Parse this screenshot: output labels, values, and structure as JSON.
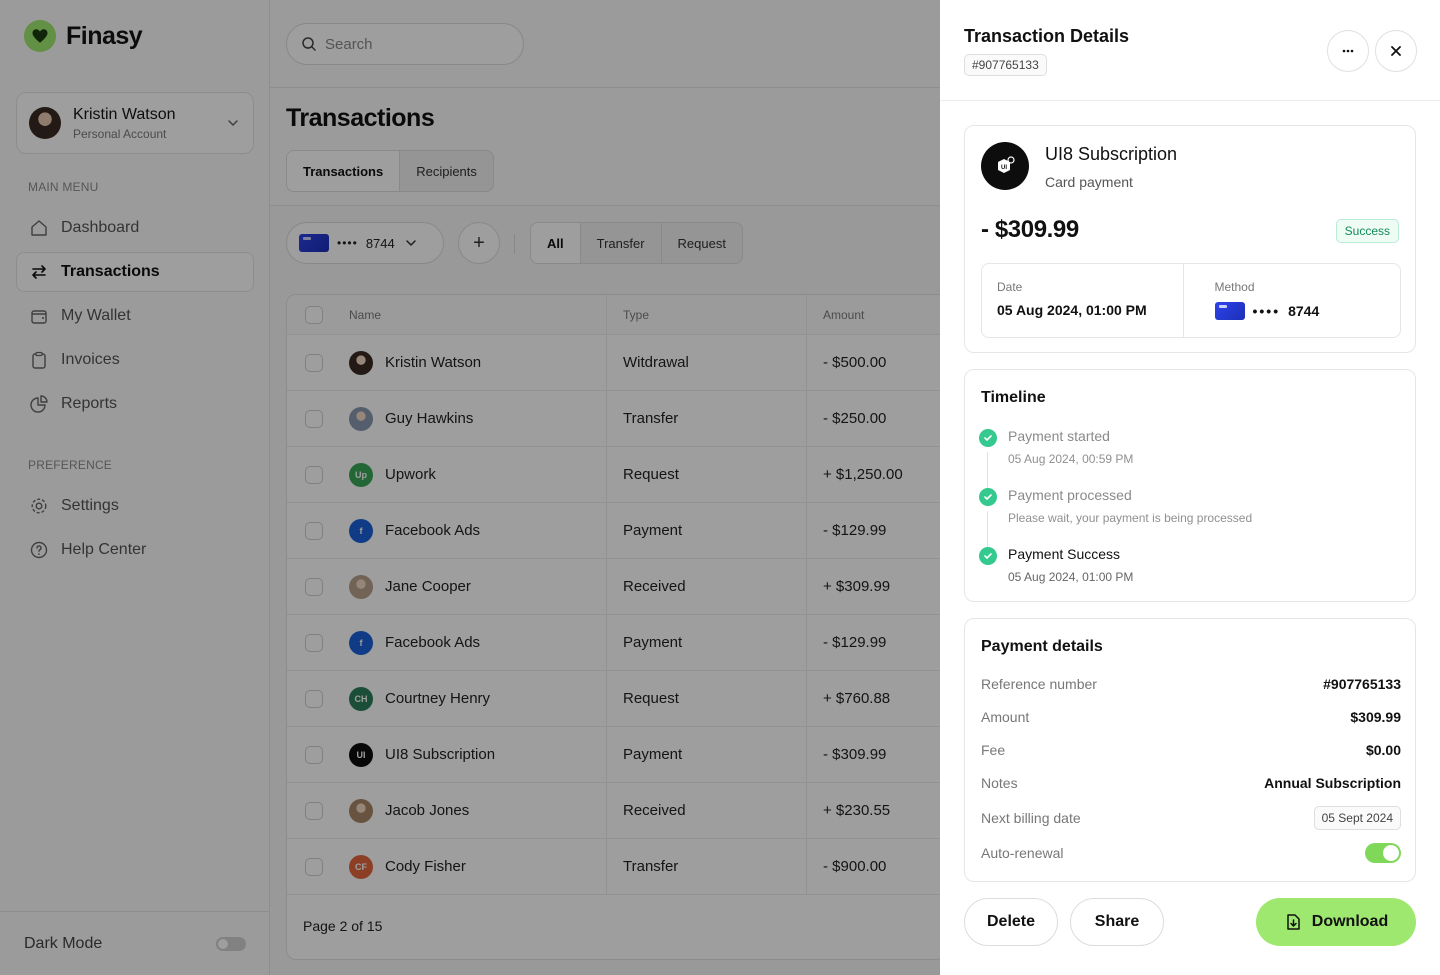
{
  "app": {
    "brand": "Finasy",
    "account": {
      "name": "Kristin Watson",
      "subtitle": "Personal Account"
    },
    "main_menu_label": "MAIN MENU",
    "preference_label": "PREFERENCE",
    "nav": [
      {
        "label": "Dashboard",
        "icon": "home-icon"
      },
      {
        "label": "Transactions",
        "icon": "transfer-icon",
        "active": true
      },
      {
        "label": "My Wallet",
        "icon": "wallet-icon"
      },
      {
        "label": "Invoices",
        "icon": "clipboard-icon"
      },
      {
        "label": "Reports",
        "icon": "pie-chart-icon"
      }
    ],
    "pref_nav": [
      {
        "label": "Settings",
        "icon": "gear-icon"
      },
      {
        "label": "Help Center",
        "icon": "help-icon"
      }
    ],
    "dark_mode_label": "Dark Mode"
  },
  "main": {
    "search_placeholder": "Search",
    "page_title": "Transactions",
    "tabs": [
      "Transactions",
      "Recipients"
    ],
    "card_last4": "8744",
    "card_dots": "••••",
    "plus_label": "+",
    "filters": [
      "All",
      "Transfer",
      "Request"
    ],
    "table": {
      "columns": [
        "Name",
        "Type",
        "Amount"
      ],
      "rows": [
        {
          "name": "Kristin Watson",
          "type": "Witdrawal",
          "amount": "- $500.00",
          "avatar": "photo",
          "color": "#3a2a22",
          "initials": ""
        },
        {
          "name": "Guy Hawkins",
          "type": "Transfer",
          "amount": "- $250.00",
          "avatar": "photo",
          "color": "#8a98b0",
          "initials": ""
        },
        {
          "name": "Upwork",
          "type": "Request",
          "amount": "+ $1,250.00",
          "avatar": "logo",
          "color": "#3aa757",
          "initials": "Up"
        },
        {
          "name": "Facebook Ads",
          "type": "Payment",
          "amount": "- $129.99",
          "avatar": "logo",
          "color": "#1a5fd8",
          "initials": "f"
        },
        {
          "name": "Jane Cooper",
          "type": "Received",
          "amount": "+ $309.99",
          "avatar": "photo",
          "color": "#b7a08c",
          "initials": ""
        },
        {
          "name": "Facebook Ads",
          "type": "Payment",
          "amount": "- $129.99",
          "avatar": "logo",
          "color": "#1a5fd8",
          "initials": "f"
        },
        {
          "name": "Courtney Henry",
          "type": "Request",
          "amount": "+ $760.88",
          "avatar": "initials",
          "color": "#2d7f5c",
          "initials": "CH"
        },
        {
          "name": "UI8 Subscription",
          "type": "Payment",
          "amount": "- $309.99",
          "avatar": "logo",
          "color": "#0d0d0d",
          "initials": "UI"
        },
        {
          "name": "Jacob Jones",
          "type": "Received",
          "amount": "+ $230.55",
          "avatar": "photo",
          "color": "#a8866a",
          "initials": ""
        },
        {
          "name": "Cody Fisher",
          "type": "Transfer",
          "amount": "- $900.00",
          "avatar": "initials",
          "color": "#e2663c",
          "initials": "CF"
        }
      ]
    },
    "pager": "Page 2 of 15"
  },
  "drawer": {
    "title": "Transaction Details",
    "id": "#907765133",
    "summary": {
      "merchant": "UI8 Subscription",
      "method_label": "Card payment",
      "amount": "- $309.99",
      "status": "Success",
      "date_label": "Date",
      "date_value": "05 Aug 2024, 01:00 PM",
      "method_title": "Method",
      "card_dots": "••••",
      "card_last4": "8744"
    },
    "timeline": {
      "title": "Timeline",
      "items": [
        {
          "title": "Payment started",
          "desc": "05 Aug 2024, 00:59 PM"
        },
        {
          "title": "Payment processed",
          "desc": "Please wait, your payment is being processed"
        },
        {
          "title": "Payment Success",
          "desc": "05 Aug 2024, 01:00 PM"
        }
      ]
    },
    "payment": {
      "title": "Payment details",
      "rows": [
        {
          "label": "Reference number",
          "value": "#907765133"
        },
        {
          "label": "Amount",
          "value": "$309.99"
        },
        {
          "label": "Fee",
          "value": "$0.00"
        },
        {
          "label": "Notes",
          "value": "Annual Subscription"
        }
      ],
      "next_billing_label": "Next billing date",
      "next_billing_value": "05 Sept 2024",
      "auto_renewal_label": "Auto-renewal",
      "auto_renewal_on": true
    },
    "actions": {
      "delete": "Delete",
      "share": "Share",
      "download": "Download"
    }
  },
  "colors": {
    "accent": "#9ee86f",
    "success": "#34c98e",
    "card": "#2d43e8"
  }
}
